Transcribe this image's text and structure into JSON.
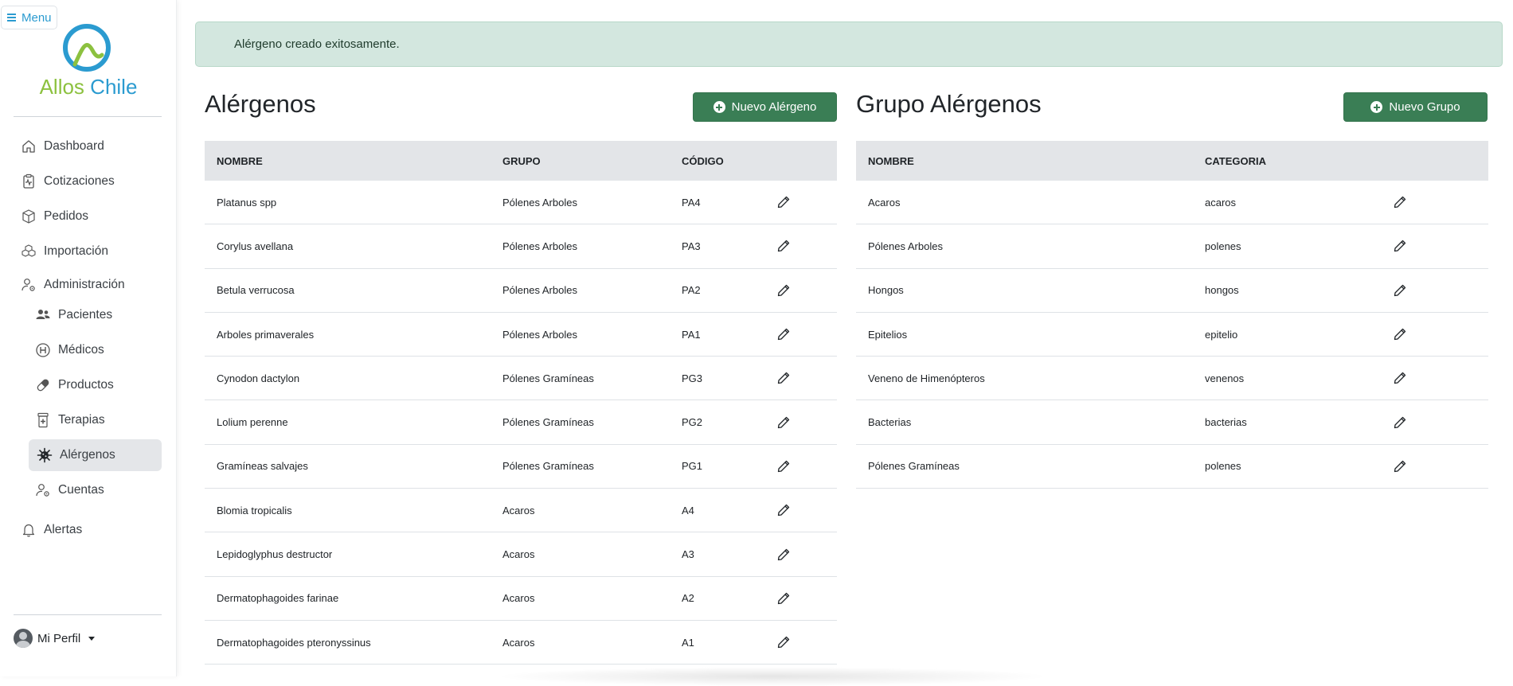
{
  "sidebar": {
    "menu_label": "Menu",
    "brand": {
      "word1": "Allos",
      "word2": "Chile"
    },
    "items": [
      {
        "label": "Dashboard",
        "icon": "home-icon"
      },
      {
        "label": "Cotizaciones",
        "icon": "clipboard-pulse-icon"
      },
      {
        "label": "Pedidos",
        "icon": "box-icon"
      },
      {
        "label": "Importación",
        "icon": "boxes-icon"
      },
      {
        "label": "Administración",
        "icon": "person-gear-icon"
      },
      {
        "label": "Pacientes",
        "icon": "people-icon"
      },
      {
        "label": "Médicos",
        "icon": "hospital-h-icon"
      },
      {
        "label": "Productos",
        "icon": "capsule-icon"
      },
      {
        "label": "Terapias",
        "icon": "prescription-icon"
      },
      {
        "label": "Alérgenos",
        "icon": "virus-icon",
        "active": true
      },
      {
        "label": "Cuentas",
        "icon": "person-gear-icon"
      },
      {
        "label": "Alertas",
        "icon": "bell-icon"
      }
    ],
    "profile_label": "Mi Perfil"
  },
  "alert": {
    "message": "Alérgeno creado exitosamente."
  },
  "allergens": {
    "title": "Alérgenos",
    "new_button": "Nuevo Alérgeno",
    "columns": [
      "NOMBRE",
      "GRUPO",
      "CÓDIGO"
    ],
    "rows": [
      [
        "Platanus spp",
        "Pólenes Arboles",
        "PA4"
      ],
      [
        "Corylus avellana",
        "Pólenes Arboles",
        "PA3"
      ],
      [
        "Betula verrucosa",
        "Pólenes Arboles",
        "PA2"
      ],
      [
        "Arboles primaverales",
        "Pólenes Arboles",
        "PA1"
      ],
      [
        "Cynodon dactylon",
        "Pólenes Gramíneas",
        "PG3"
      ],
      [
        "Lolium perenne",
        "Pólenes Gramíneas",
        "PG2"
      ],
      [
        "Gramíneas salvajes",
        "Pólenes Gramíneas",
        "PG1"
      ],
      [
        "Blomia tropicalis",
        "Acaros",
        "A4"
      ],
      [
        "Lepidoglyphus destructor",
        "Acaros",
        "A3"
      ],
      [
        "Dermatophagoides farinae",
        "Acaros",
        "A2"
      ],
      [
        "Dermatophagoides pteronyssinus",
        "Acaros",
        "A1"
      ]
    ]
  },
  "groups": {
    "title": "Grupo Alérgenos",
    "new_button": "Nuevo Grupo",
    "columns": [
      "NOMBRE",
      "CATEGORIA"
    ],
    "rows": [
      [
        "Acaros",
        "acaros"
      ],
      [
        "Pólenes Arboles",
        "polenes"
      ],
      [
        "Hongos",
        "hongos"
      ],
      [
        "Epitelios",
        "epitelio"
      ],
      [
        "Veneno de Himenópteros",
        "venenos"
      ],
      [
        "Bacterias",
        "bacterias"
      ],
      [
        "Pólenes Gramíneas",
        "polenes"
      ]
    ]
  },
  "colors": {
    "brand_green": "#8cc13f",
    "brand_blue": "#2b9bd0",
    "button_green": "#3a7e55",
    "alert_bg": "#d3e7df",
    "header_bg": "#e3e5e8"
  }
}
